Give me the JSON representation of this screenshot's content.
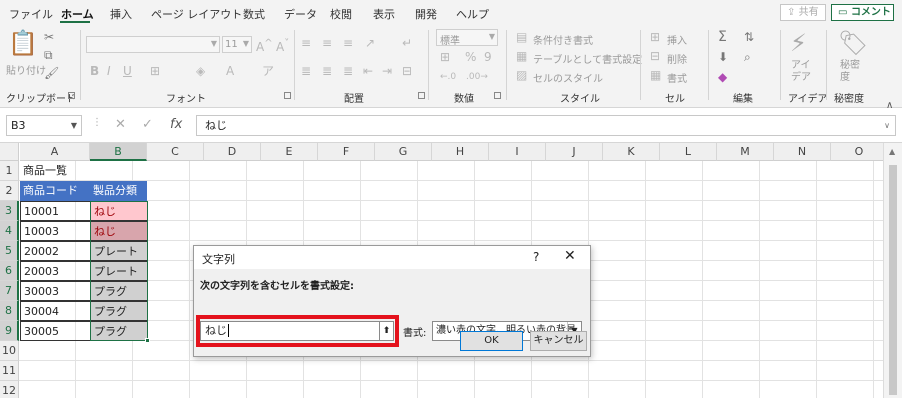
{
  "menu": {
    "tabs": [
      "ファイル",
      "ホーム",
      "挿入",
      "ページ レイアウト",
      "数式",
      "データ",
      "校閲",
      "表示",
      "開発",
      "ヘルプ"
    ],
    "active_tab": "ホーム",
    "share": "共有",
    "comment": "コメント"
  },
  "ribbon": {
    "clipboard": {
      "label": "クリップボード",
      "paste": "貼り付け"
    },
    "font": {
      "label": "フォント",
      "size": "11"
    },
    "alignment": {
      "label": "配置"
    },
    "number": {
      "label": "数値",
      "format": "標準"
    },
    "styles": {
      "label": "スタイル",
      "conditional": "条件付き書式",
      "table": "テーブルとして書式設定",
      "cell_styles": "セルのスタイル"
    },
    "cells": {
      "label": "セル",
      "insert": "挿入",
      "delete": "削除",
      "format": "書式"
    },
    "editing": {
      "label": "編集"
    },
    "ideas": {
      "label": "アイデア",
      "button": "アイデア"
    },
    "sensitivity": {
      "label": "秘密度",
      "button": "秘密度"
    }
  },
  "formula_bar": {
    "name_box": "B3",
    "fx": "fx",
    "content": "ねじ"
  },
  "columns": [
    "A",
    "B",
    "C",
    "D",
    "E",
    "F",
    "G",
    "H",
    "I",
    "J",
    "K",
    "L",
    "M",
    "N",
    "O"
  ],
  "rows": [
    "1",
    "2",
    "3",
    "4",
    "5",
    "6",
    "7",
    "8",
    "9",
    "10",
    "11",
    "12"
  ],
  "sheet": {
    "title": "商品一覧",
    "headers": [
      "商品コード",
      "製品分類"
    ],
    "data": [
      [
        "10001",
        "ねじ"
      ],
      [
        "10003",
        "ねじ"
      ],
      [
        "20002",
        "プレート"
      ],
      [
        "20003",
        "プレート"
      ],
      [
        "30003",
        "プラグ"
      ],
      [
        "30004",
        "プラグ"
      ],
      [
        "30005",
        "プラグ"
      ]
    ]
  },
  "dialog": {
    "title": "文字列",
    "help": "?",
    "close": "✕",
    "instruction": "次の文字列を含むセルを書式設定:",
    "input_value": "ねじ",
    "format_label": "書式:",
    "format_value": "濃い赤の文字、明るい赤の背景",
    "ok": "OK",
    "cancel": "キャンセル"
  },
  "colors": {
    "accent": "#1e7145",
    "header_fill": "#4472c4",
    "highlight_light_red": "#ffc7ce",
    "highlight_dark_red_text": "#9c0006",
    "callout_red": "#e4121c"
  }
}
